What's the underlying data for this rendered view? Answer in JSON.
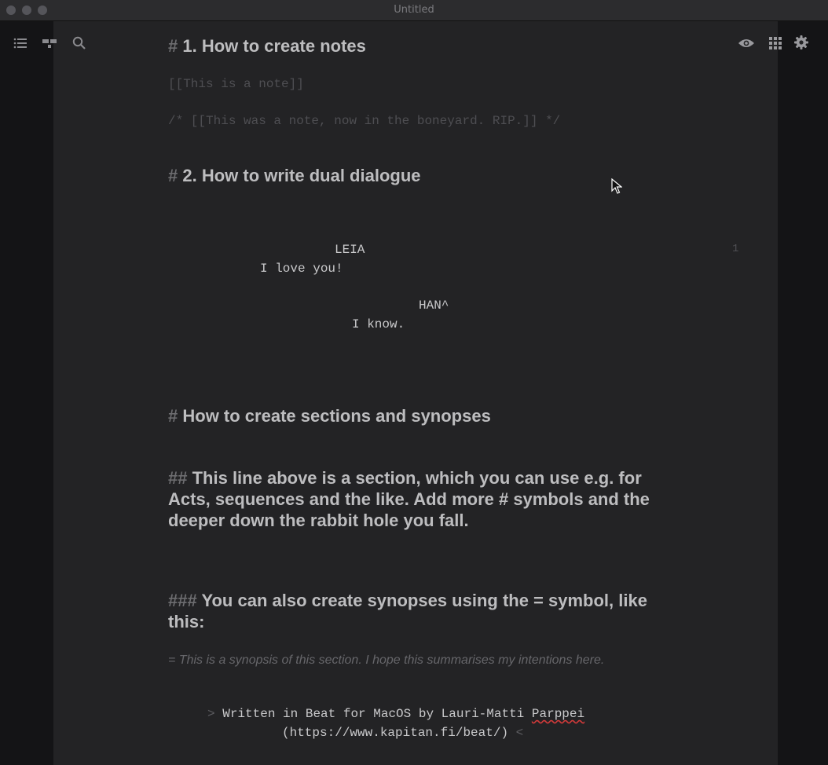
{
  "window": {
    "title": "Untitled"
  },
  "toolbar": {
    "left_icons": [
      "list-icon",
      "cards-icon",
      "search-icon"
    ],
    "right_icons": [
      "eye-icon",
      "grid-icon",
      "gear-icon"
    ]
  },
  "document": {
    "heading1": {
      "hash": "#",
      "text": "1. How to create notes"
    },
    "note_line": "[[This is a note]]",
    "boneyard_line": "/* [[This was a note, now in the boneyard. RIP.]] */",
    "heading2": {
      "hash": "#",
      "text": "2. How to write dual dialogue"
    },
    "dual_dialogue": {
      "char1": "LEIA",
      "line1": "I love you!",
      "char2": "HAN^",
      "line2": "I know.",
      "page_number": "1"
    },
    "heading3": {
      "hash": "#",
      "text": "How to create sections and synopses"
    },
    "section2": {
      "hash": "##",
      "line1": "This line above is a section, which you can use e.g. for",
      "line2": "Acts, sequences and the like. Add more # symbols and the",
      "line3": "deeper down the rabbit hole you fall."
    },
    "section3": {
      "hash": "###",
      "line1": "You can also create synopses using the = symbol, like",
      "line2": "this:"
    },
    "synopsis": "= This is a synopsis of this section. I hope this summarises my intentions here.",
    "centered": {
      "open": ">",
      "line1_text": "Written in Beat for MacOS by Lauri-Matti",
      "line1_misspelled": "Parppei",
      "line2_text": "(https://www.kapitan.fi/beat/)",
      "close": "<"
    }
  },
  "colors": {
    "background": "#1b1b1d",
    "paper": "#232325",
    "text": "#c9c9cb",
    "muted": "#6d6d70"
  }
}
